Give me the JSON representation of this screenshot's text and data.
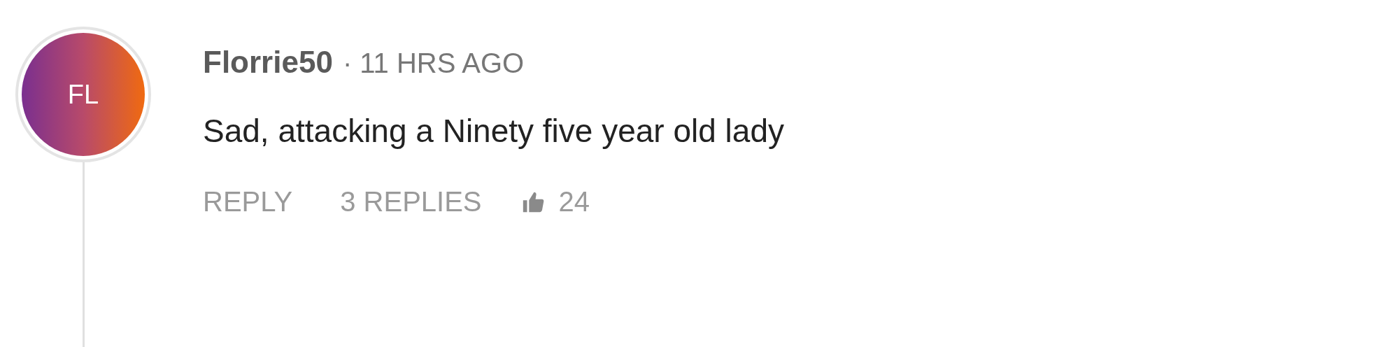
{
  "comment": {
    "avatar_initials": "FL",
    "username": "Florrie50",
    "time": "· 11 HRS AGO",
    "text": "Sad, attacking a Ninety five year old lady",
    "actions": {
      "reply": "REPLY",
      "replies": "3 REPLIES",
      "likes": "24"
    }
  }
}
